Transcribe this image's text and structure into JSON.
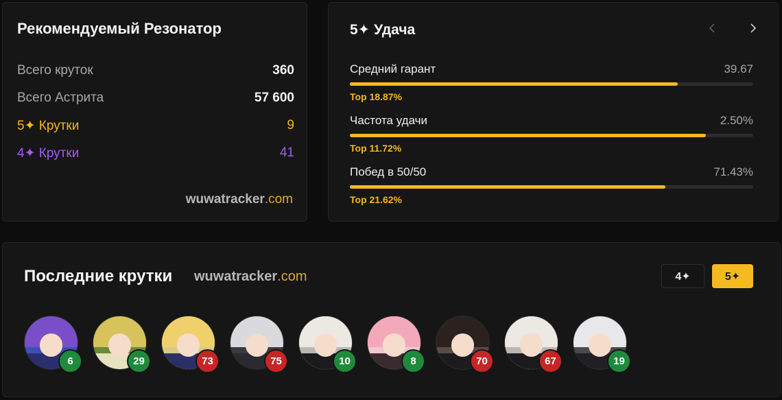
{
  "resonator": {
    "title": "Рекомендуемый Резонатор",
    "stats": [
      {
        "label": "Всего круток",
        "value": "360",
        "tone": "default"
      },
      {
        "label": "Всего Астрита",
        "value": "57 600",
        "tone": "default"
      },
      {
        "label": "5✦ Крутки",
        "value": "9",
        "tone": "gold"
      },
      {
        "label": "4✦ Крутки",
        "value": "41",
        "tone": "purple"
      }
    ],
    "watermark": {
      "name": "wuwatracker",
      "tld": ".com"
    }
  },
  "luck": {
    "title": "5✦ Удача",
    "nav": {
      "prev_icon": "chevron-left-icon",
      "next_icon": "chevron-right-icon"
    },
    "metrics": [
      {
        "label": "Средний гарант",
        "value": "39.67",
        "top": "Top 18.87%",
        "fill_fraction": 0.813
      },
      {
        "label": "Частота удачи",
        "value": "2.50%",
        "top": "Top 11.72%",
        "fill_fraction": 0.883
      },
      {
        "label": "Побед в 50/50",
        "value": "71.43%",
        "top": "Top 21.62%",
        "fill_fraction": 0.783
      }
    ]
  },
  "recent_pulls": {
    "title": "Последние крутки",
    "watermark": {
      "name": "wuwatracker",
      "tld": ".com"
    },
    "filters": [
      {
        "label": "4✦",
        "active": false
      },
      {
        "label": "5✦",
        "active": true
      }
    ],
    "items": [
      {
        "pity": "6",
        "status": "low"
      },
      {
        "pity": "29",
        "status": "low"
      },
      {
        "pity": "73",
        "status": "high"
      },
      {
        "pity": "75",
        "status": "high"
      },
      {
        "pity": "10",
        "status": "low"
      },
      {
        "pity": "8",
        "status": "low"
      },
      {
        "pity": "70",
        "status": "high"
      },
      {
        "pity": "67",
        "status": "high"
      },
      {
        "pity": "19",
        "status": "low"
      }
    ]
  },
  "colors": {
    "accent_gold": "#f5b921",
    "accent_purple": "#a35cf0",
    "badge_low": "#1f8a3c",
    "badge_high": "#c62626"
  }
}
